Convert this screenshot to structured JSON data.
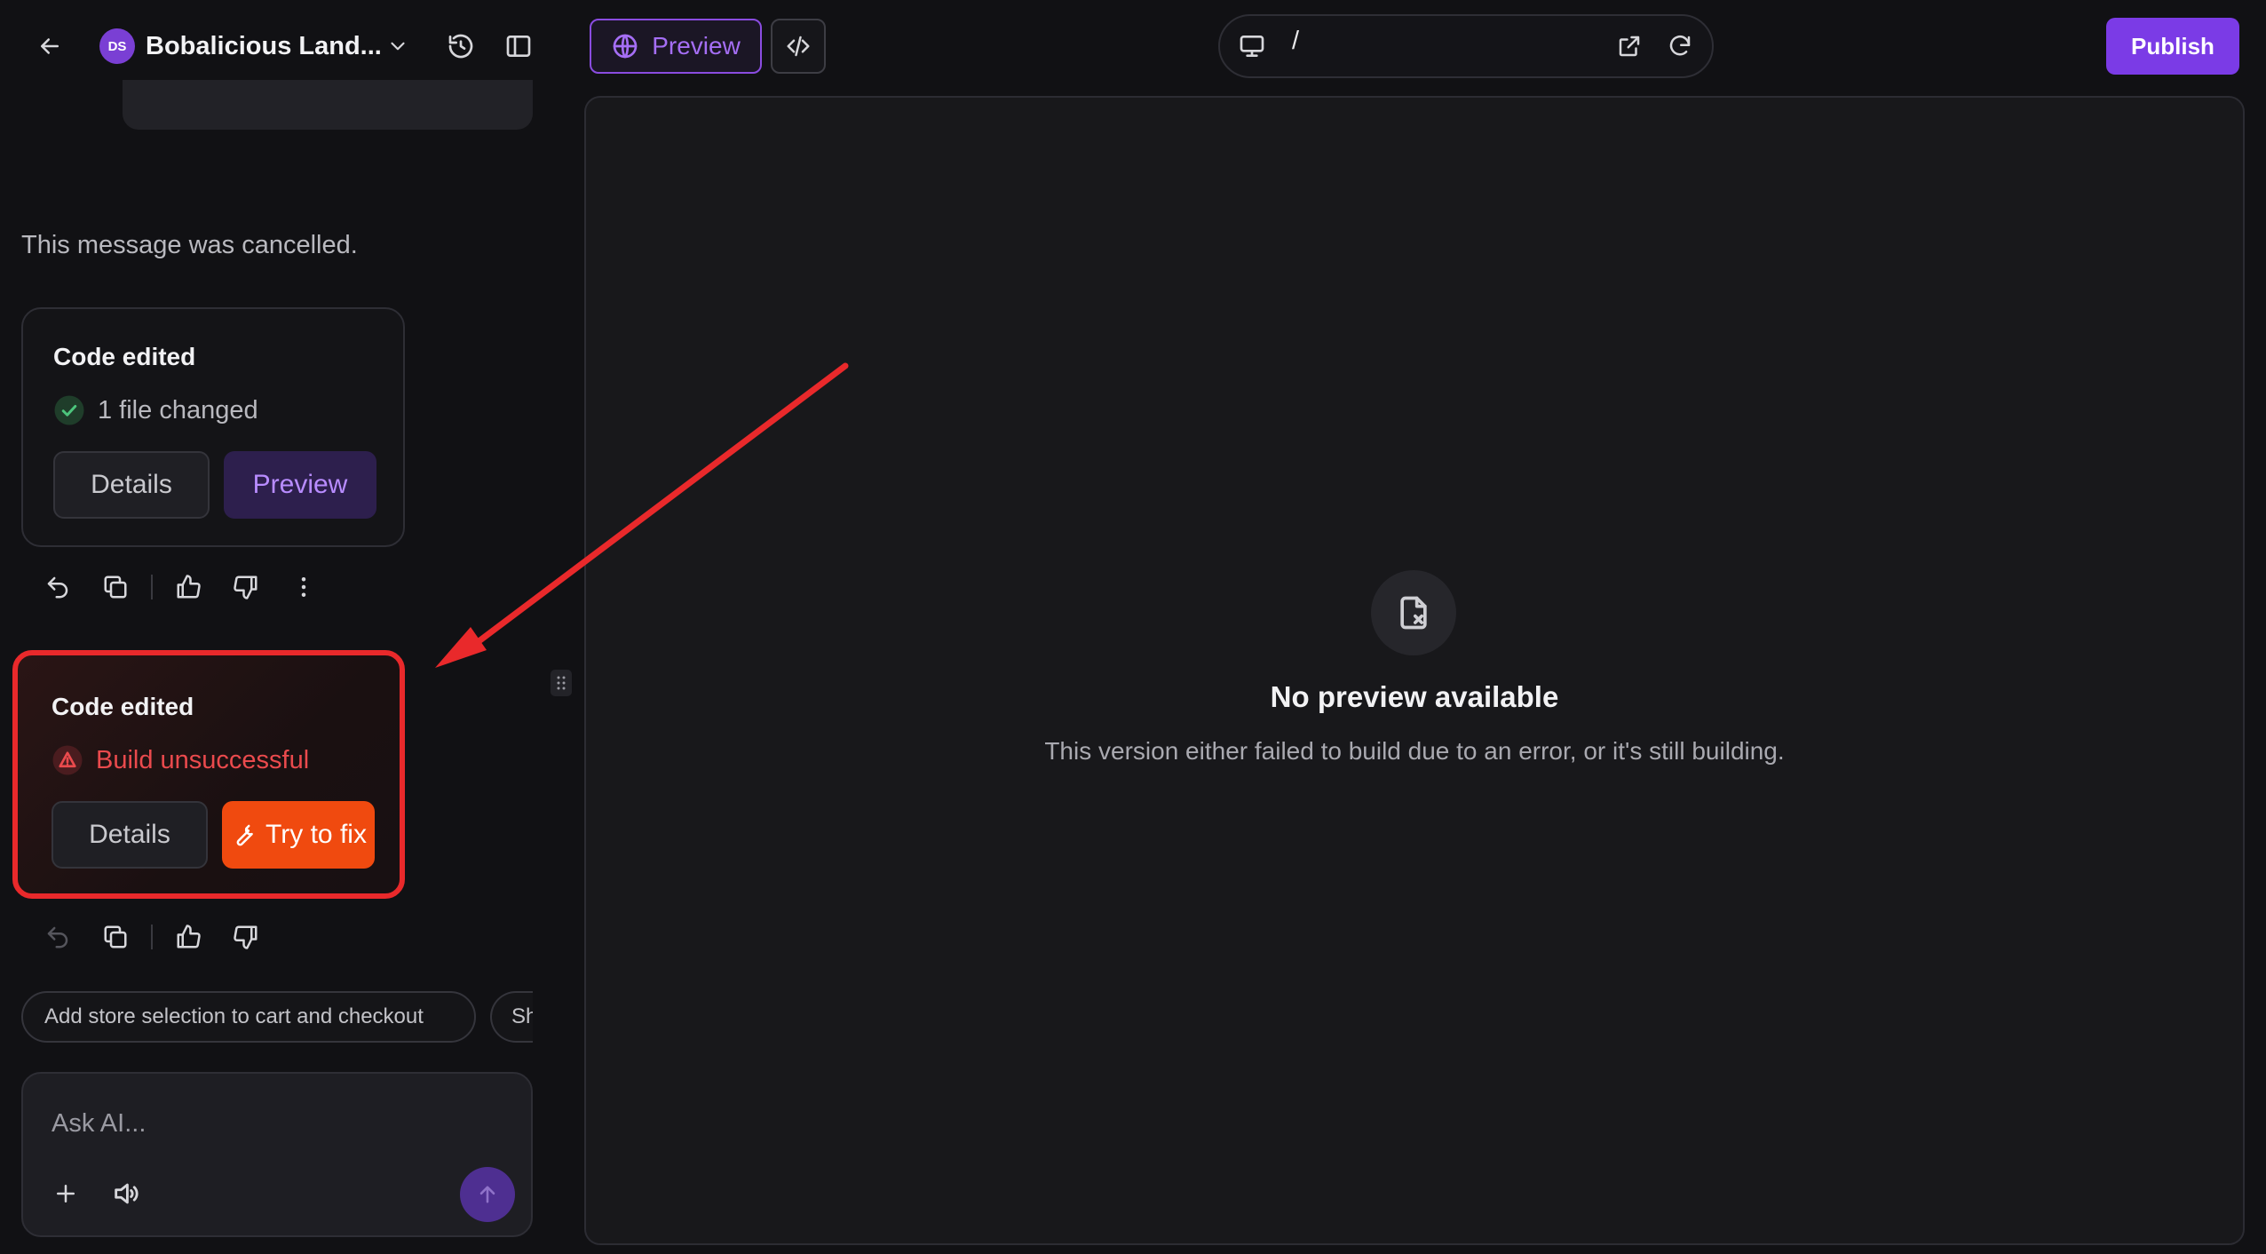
{
  "header": {
    "project_initials": "DS",
    "project_name": "Bobalicious Land...",
    "preview_tab_label": "Preview",
    "url_path": "/",
    "publish_label": "Publish"
  },
  "chat": {
    "cancelled_message": "This message was cancelled.",
    "cards": [
      {
        "title": "Code edited",
        "status": "1 file changed",
        "status_kind": "success",
        "buttons": [
          "Details",
          "Preview"
        ]
      },
      {
        "title": "Code edited",
        "status": "Build unsuccessful",
        "status_kind": "error",
        "buttons": [
          "Details",
          "Try to fix"
        ]
      }
    ],
    "suggestions": [
      "Add store selection to cart and checkout",
      "Sh"
    ],
    "composer_placeholder": "Ask AI..."
  },
  "preview": {
    "empty_title": "No preview available",
    "empty_description": "This version either failed to build due to an error, or it's still building."
  },
  "colors": {
    "accent": "#7b3be6",
    "success": "#37b36b",
    "error": "#e5484d",
    "fix_button": "#f04a0f",
    "annotation": "#e9292b"
  }
}
